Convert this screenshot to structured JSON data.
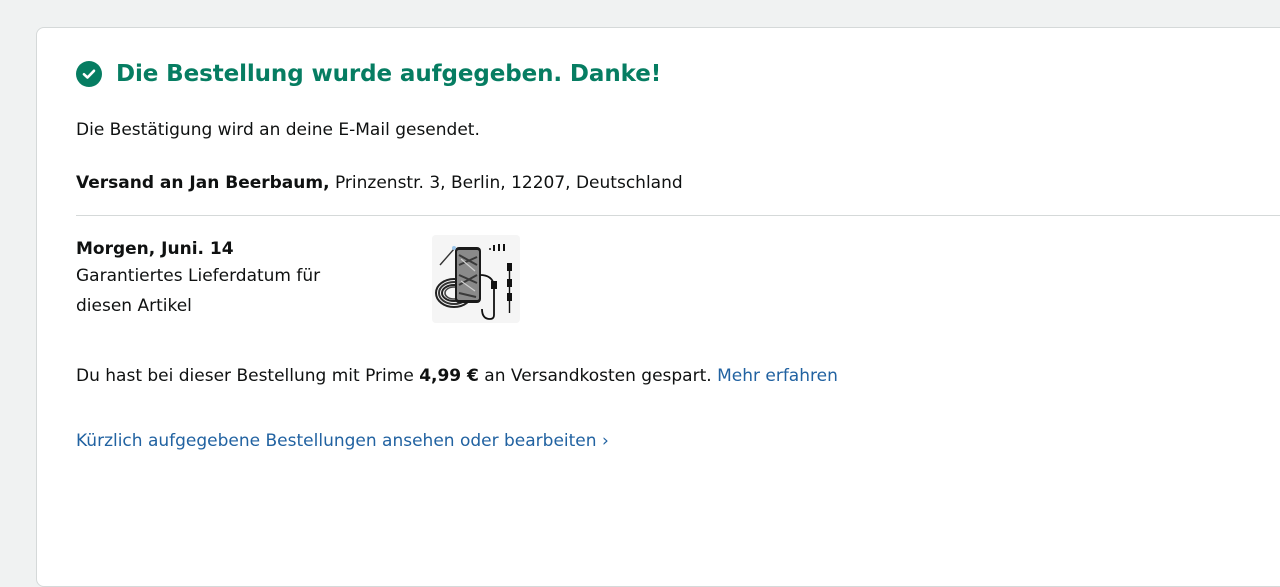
{
  "confirmation": {
    "heading": "Die Bestellung wurde aufgegeben. Danke!",
    "email_note": "Die Bestätigung wird an deine E-Mail gesendet."
  },
  "shipping": {
    "recipient": "Versand an Jan Beerbaum,",
    "address": " Prinzenstr. 3, Berlin, 12207, Deutschland"
  },
  "delivery": {
    "date": "Morgen, Juni. 14",
    "note": "Garantiertes Lieferdatum für diesen Artikel"
  },
  "product": {
    "image_icon": "endoscope-camera-product-image"
  },
  "prime": {
    "text_before": "Du hast bei dieser Bestellung mit Prime ",
    "amount": "4,99 €",
    "text_after": " an Versandkosten gespart. ",
    "learn_more": "Mehr erfahren"
  },
  "orders_link": "Kürzlich aufgegebene Bestellungen ansehen oder bearbeiten ›",
  "colors": {
    "success_green": "#067d62",
    "link_blue": "#2162a1",
    "page_bg": "#f0f2f2"
  }
}
